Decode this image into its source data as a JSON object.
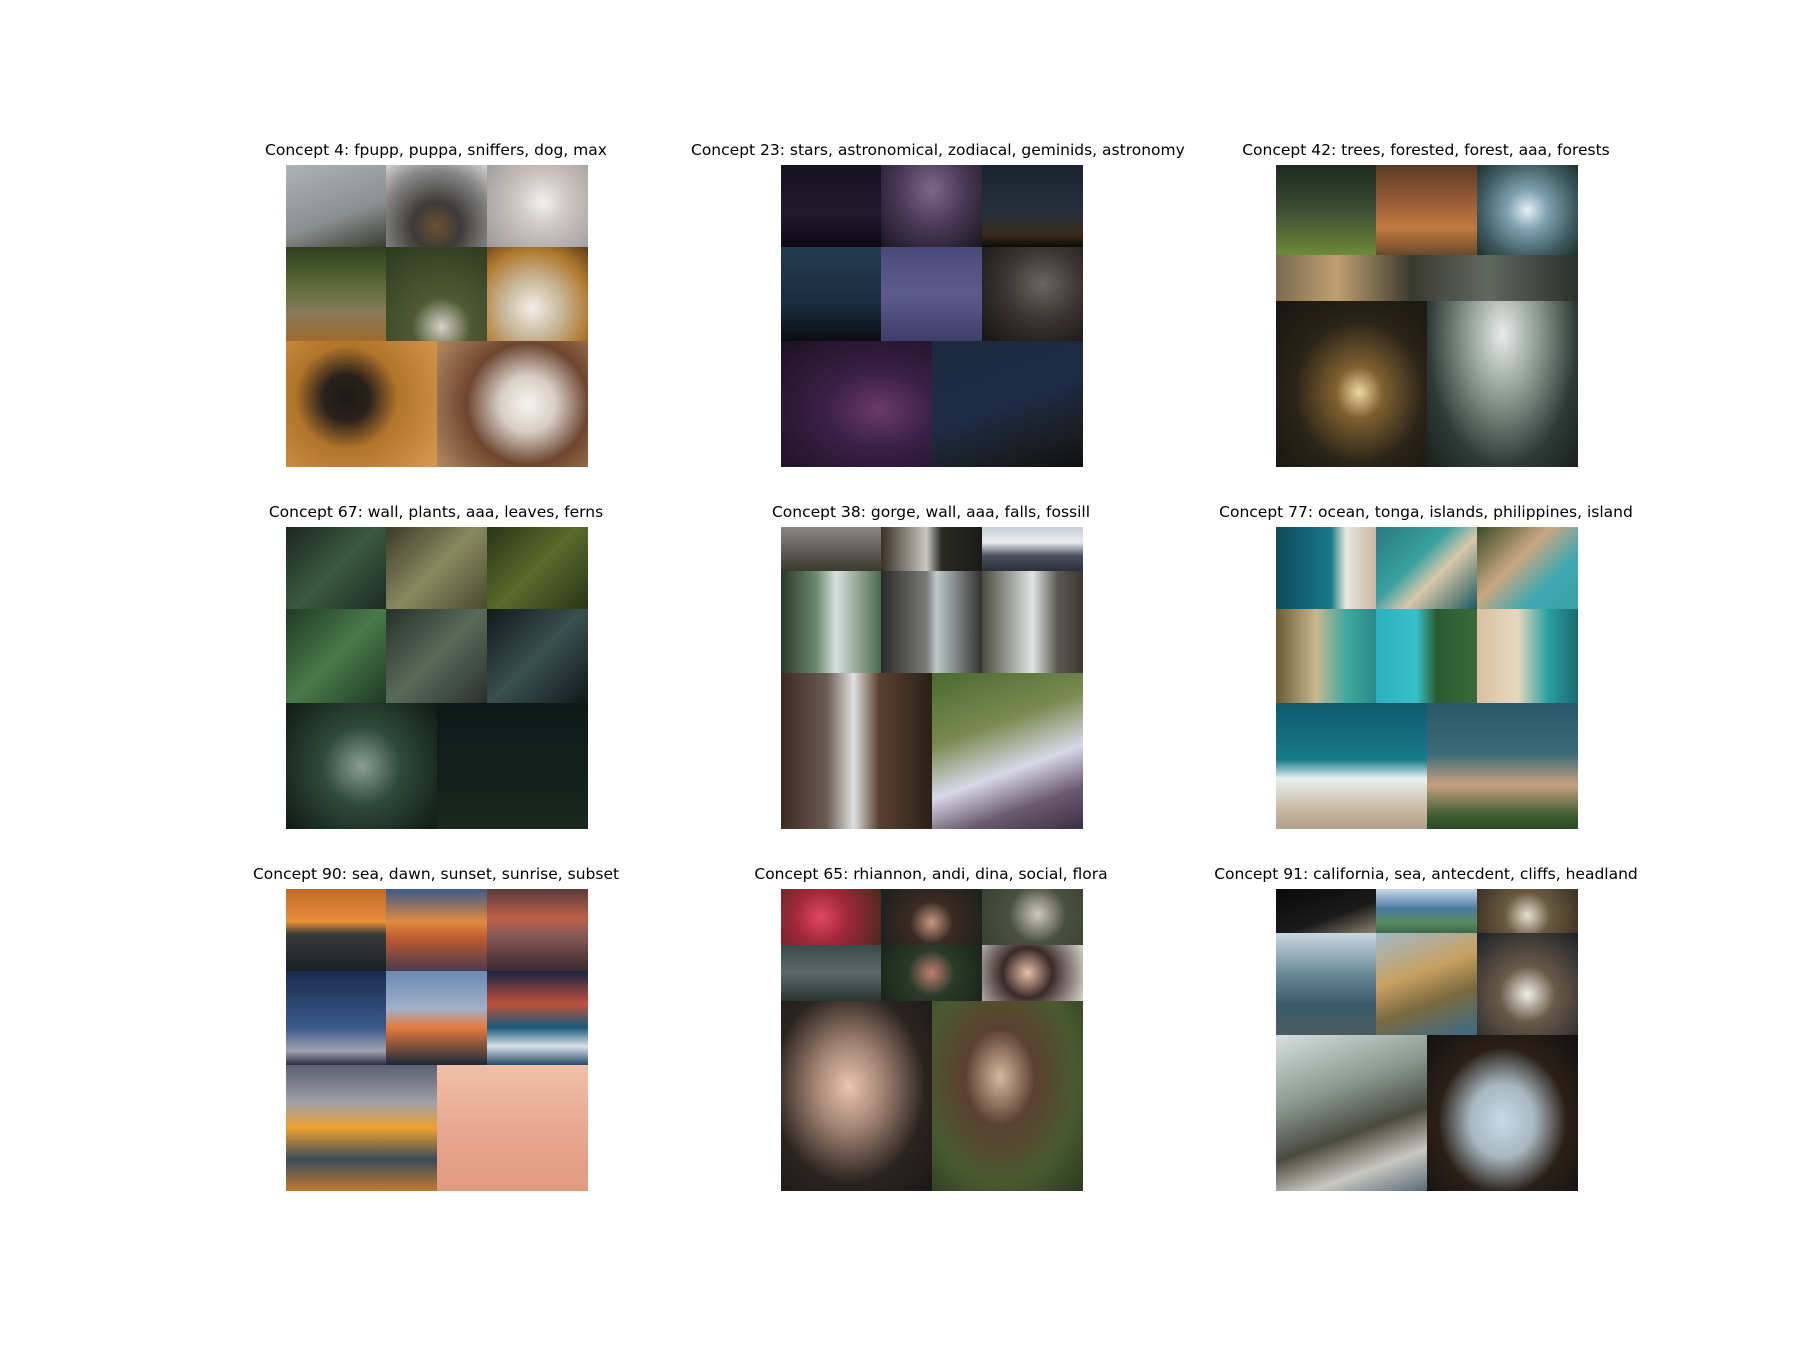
{
  "figure": {
    "panels": [
      {
        "title": "Concept 4: fpupp, puppa, sniffers, dog, max",
        "tiles": [
          {
            "bg": "linear-gradient(160deg,#aeb3b5 0%,#8a9090 60%,#3a3b33 100%)"
          },
          {
            "bg": "radial-gradient(circle at 50% 75%,#6b5032 0%,#3d3b38 30%,#858585 70%,#d3d3d3 100%)"
          },
          {
            "bg": "radial-gradient(circle at 55% 45%,#f2f0ee 0%,#cfc8c4 35%,#9b9896 100%)"
          },
          {
            "bg": "linear-gradient(180deg,#2f3f1c 0%,#5a6a3a 40%,#8a7a5a 70%,#a06a30 100%)"
          },
          {
            "bg": "radial-gradient(circle at 55% 85%,#d7d2c8 0%,#4f5a34 30%,#2a3a1d 100%)"
          },
          {
            "bg": "radial-gradient(circle at 45% 65%,#f3efe8 0%,#c9b89a 35%,#b07a30 70%,#5a3a14 100%)"
          },
          {
            "bg": "radial-gradient(circle at 40% 45%,#1c1a18 0%,#2a211a 20%,#b0742a 45%,#d89a50 100%)"
          },
          {
            "bg": "radial-gradient(circle at 60% 50%,#f7f4f0 0%,#d8cfc6 25%,#6e4630 55%,#b48a60 100%)"
          }
        ]
      },
      {
        "title": "Concept 23: stars, astronomical, zodiacal, geminids, astronomy",
        "tiles": [
          {
            "bg": "linear-gradient(180deg,#15121f 0%,#201a2d 60%,#0d0a12 100%)"
          },
          {
            "bg": "radial-gradient(ellipse at 50% 30%,#7a6a88 0%,#4a3b5a 45%,#1b1520 100%)"
          },
          {
            "bg": "linear-gradient(180deg,#1a2430 0%,#26303c 60%,#3a2a1a 85%,#0b0b0b 100%)"
          },
          {
            "bg": "linear-gradient(180deg,#223a4f 0%,#1b2d40 60%,#0a0d10 100%)"
          },
          {
            "bg": "linear-gradient(180deg,#4a4a7a 0%,#5d5b8e 50%,#3d3e6a 100%)"
          },
          {
            "bg": "radial-gradient(ellipse at 60% 40%,#6c6560 0%,#3a3432 45%,#151312 100%)"
          },
          {
            "bg": "radial-gradient(ellipse at 65% 55%,#6a3a6a 0%,#3a1f45 40%,#1a1023 100%)"
          },
          {
            "bg": "linear-gradient(160deg,#1c2a40 0%,#1d2b45 50%,#1a1d22 80%,#0f1010 100%)"
          }
        ]
      },
      {
        "title": "Concept 42: trees, forested, forest, aaa, forests",
        "tiles": [
          {
            "bg": "linear-gradient(180deg,#1e2a20 0%,#3d4c32 50%,#6d8a3a 100%)"
          },
          {
            "bg": "linear-gradient(180deg,#5a3a24 0%,#a0603a 45%,#c07a40 70%,#6a4a2a 100%)"
          },
          {
            "bg": "radial-gradient(circle at 50% 50%,#e9f0f4 0%,#7ea0b0 30%,#3e5a60 70%,#203028 100%)"
          },
          {
            "bg": "linear-gradient(90deg,#7a6a50 0%,#c0a070 20%,#3a3a30 45%,#606860 70%,#2a302a 100%)"
          },
          {
            "bg": "radial-gradient(ellipse at 55% 55%,#f0d8a0 0%,#806030 20%,#2a2418 55%,#141410 100%)"
          },
          {
            "bg": "radial-gradient(ellipse at 50% 20%,#e8ecea 0%,#8a9890 35%,#2e3a36 70%,#1a201c 100%)"
          }
        ]
      },
      {
        "title": "Concept 67: wall, plants, aaa, leaves, ferns",
        "tiles": [
          {
            "bg": "linear-gradient(135deg,#1a2820 0%,#3a5a40 50%,#1c2a22 100%)"
          },
          {
            "bg": "linear-gradient(135deg,#3a3a28 0%,#8a8a60 50%,#4a4830 100%)"
          },
          {
            "bg": "linear-gradient(135deg,#2a3418 0%,#5a6a2a 50%,#2a3418 100%)"
          },
          {
            "bg": "linear-gradient(135deg,#1f3a24 0%,#4a7a4a 50%,#1f3a24 100%)"
          },
          {
            "bg": "linear-gradient(135deg,#28302a 0%,#5a6a5a 50%,#2a302c 100%)"
          },
          {
            "bg": "linear-gradient(135deg,#10181a 0%,#3a5050 50%,#10181a 100%)"
          },
          {
            "bg": "radial-gradient(circle at 50% 50%,#8aa090 0%,#2e4a3a 40%,#0f1a14 100%)"
          },
          {
            "bg": "linear-gradient(180deg,#0f1a18 0%,#12201c 60%,#1a2a1c 100%)"
          }
        ]
      },
      {
        "title": "Concept 38: gorge, wall, aaa, falls, fossill",
        "tiles": [
          {
            "bg": "linear-gradient(180deg,#8a8880 0%,#5a5850 60%,#3a3a30 100%)"
          },
          {
            "bg": "linear-gradient(90deg,#3a3028 0%,#c8c8c0 45%,#2a2a24 60%,#1a1a18 100%)"
          },
          {
            "bg": "linear-gradient(180deg,#c8d0d8 0%,#e8ecee 35%,#4a5060 65%,#2a3038 100%)"
          },
          {
            "bg": "linear-gradient(90deg,#2a3a28 0%,#6a8a6a 35%,#d8e0e0 55%,#4a6a4a 100%)"
          },
          {
            "bg": "linear-gradient(90deg,#2a2a28 0%,#7a7a78 45%,#c0c8c8 55%,#303030 100%)"
          },
          {
            "bg": "linear-gradient(90deg,#4a4a40 0%,#e0e4e4 50%,#5a5850 75%,#3a3830 100%)"
          },
          {
            "bg": "linear-gradient(90deg,#3a2a20 0%,#6a5a50 30%,#e0e0e0 48%,#5a4030 65%,#2a2018 100%)"
          },
          {
            "bg": "linear-gradient(160deg,#4a6a30 0%,#7a8a50 35%,#d8d8e8 60%,#6a5a70 80%,#3a3040 100%)"
          }
        ]
      },
      {
        "title": "Concept 77: ocean, tonga, islands, philippines, island",
        "tiles": [
          {
            "bg": "linear-gradient(90deg,#0e4a5a 0%,#1a7a8a 55%,#e8e8e0 70%,#c8b8a0 100%)"
          },
          {
            "bg": "linear-gradient(135deg,#2a7a80 0%,#3aa0a0 40%,#d8c8a8 60%,#1a5a60 100%)"
          },
          {
            "bg": "linear-gradient(135deg,#3a4a28 0%,#c8a880 40%,#40a8b0 70%,#3aa0a8 100%)"
          },
          {
            "bg": "linear-gradient(90deg,#6a5a30 0%,#c8b890 40%,#40a8a0 70%,#2a8a88 100%)"
          },
          {
            "bg": "linear-gradient(90deg,#2ab0c0 0%,#38c0c8 40%,#2a5a30 60%,#3a6a3a 100%)"
          },
          {
            "bg": "linear-gradient(90deg,#d8c0a0 0%,#e8d8c0 40%,#2aa0a0 70%,#1a6a70 100%)"
          },
          {
            "bg": "linear-gradient(180deg,#0e5a6a 0%,#1a7a8a 45%,#e8f0f0 60%,#c8b8a0 85%,#b0a090 100%)"
          },
          {
            "bg": "linear-gradient(180deg,#2a5a6a 0%,#3a6a78 40%,#c8a080 65%,#3a5a30 90%,#2a4a24 100%)"
          }
        ]
      },
      {
        "title": "Concept 90: sea, dawn, sunset, sunrise, subset",
        "tiles": [
          {
            "bg": "linear-gradient(180deg,#c06a2a 0%,#e8903a 40%,#3a3a38 55%,#1a2028 100%)"
          },
          {
            "bg": "linear-gradient(180deg,#3a5a8a 0%,#e08a40 40%,#c05a30 60%,#4a3a50 100%)"
          },
          {
            "bg": "linear-gradient(180deg,#5a3a3a 0%,#c06048 35%,#8a5a5a 55%,#3a2a30 100%)"
          },
          {
            "bg": "linear-gradient(180deg,#1a2a50 0%,#3a5a8a 60%,#a0a0b0 85%,#2a3040 100%)"
          },
          {
            "bg": "linear-gradient(180deg,#6a8ab0 0%,#a0b0c8 40%,#e87a40 60%,#1a2a3a 100%)"
          },
          {
            "bg": "linear-gradient(180deg,#1a2440 0%,#c05040 35%,#1a5a7a 60%,#d8e0e8 80%,#2a4a6a 100%)"
          },
          {
            "bg": "linear-gradient(180deg,#5a6070 0%,#a0a0a8 30%,#f0a030 50%,#3a4a5a 75%,#c07a30 100%)"
          },
          {
            "bg": "linear-gradient(180deg,#f0c0a8 0%,#e8a890 50%,#e09a80 100%)"
          }
        ]
      },
      {
        "title": "Concept 65: rhiannon, andi, dina, social, flora",
        "tiles": [
          {
            "bg": "radial-gradient(circle at 40% 50%,#e04860 0%,#a02838 40%,#4a2a20 100%)"
          },
          {
            "bg": "radial-gradient(circle at 50% 60%,#c89a80 0%,#3a2a24 35%,#1a201a 100%)"
          },
          {
            "bg": "radial-gradient(circle at 55% 45%,#d0c8c0 0%,#4a5040 45%,#3a4030 100%)"
          },
          {
            "bg": "linear-gradient(180deg,#3a4a48 0%,#5a6a68 50%,#2a3430 100%)"
          },
          {
            "bg": "radial-gradient(circle at 50% 50%,#c08070 0%,#2a3a2a 40%,#1a2418 100%)"
          },
          {
            "bg": "radial-gradient(circle at 45% 50%,#e8c0a8 0%,#3a2a28 40%,#d8d4d0 100%)"
          },
          {
            "bg": "radial-gradient(ellipse at 45% 45%,#e8c8b0 0%,#a08070 30%,#2a2420 65%,#1a1818 100%)"
          },
          {
            "bg": "radial-gradient(ellipse at 45% 40%,#d8b8a0 0%,#5a4030 30%,#4a5a30 65%,#2a3a20 100%)"
          }
        ]
      },
      {
        "title": "Concept 91: california, sea, antecdent, cliffs, headland",
        "tiles": [
          {
            "bg": "linear-gradient(160deg,#0a0a0a 0%,#1a1a1a 60%,#8a8070 100%)"
          },
          {
            "bg": "linear-gradient(180deg,#c8d8e8 0%,#4a7aa0 45%,#5a8a60 75%,#3a6a4a 100%)"
          },
          {
            "bg": "radial-gradient(circle at 50% 60%,#e8e0d0 0%,#6a5a40 40%,#3a3024 100%)"
          },
          {
            "bg": "linear-gradient(180deg,#c8d8e0 0%,#6a8a98 40%,#3a5a6a 70%,#4a5a60 100%)"
          },
          {
            "bg": "linear-gradient(160deg,#a0b8c8 0%,#c8a060 40%,#7a6a40 65%,#3a6a88 100%)"
          },
          {
            "bg": "radial-gradient(circle at 50% 60%,#f0f0e8 0%,#6a5a48 35%,#1a2028 100%)"
          },
          {
            "bg": "linear-gradient(160deg,#d8e0e0 0%,#8a9a90 35%,#4a4a40 60%,#c8c8c0 80%,#5a6a78 100%)"
          },
          {
            "bg": "radial-gradient(ellipse at 50% 55%,#c8d8e8 0%,#a8b8c0 30%,#2a2018 60%,#141010 100%)"
          }
        ]
      }
    ]
  }
}
